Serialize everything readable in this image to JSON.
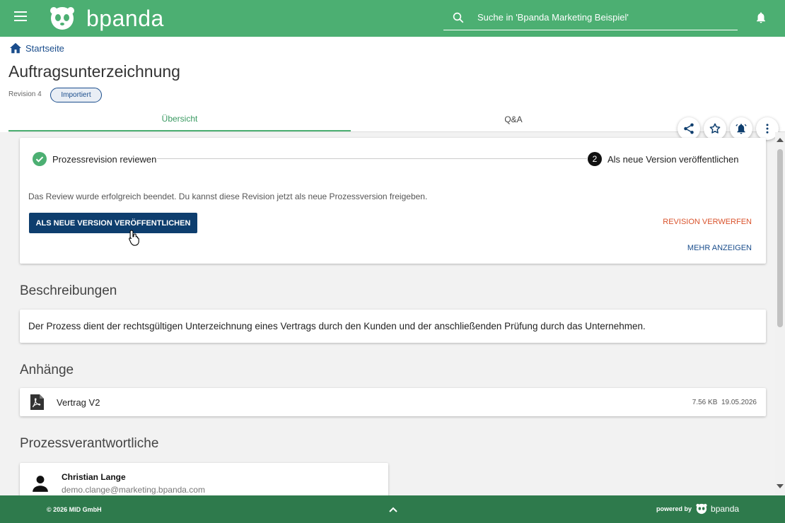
{
  "topbar": {
    "brand": "bpanda",
    "search_placeholder": "Suche in 'Bpanda Marketing Beispiel'"
  },
  "breadcrumb": {
    "home": "Startseite"
  },
  "page": {
    "title": "Auftragsunterzeichnung",
    "revision": "Revision 4",
    "status_badge": "Importiert"
  },
  "tabs": [
    {
      "label": "Übersicht",
      "active": true
    },
    {
      "label": "Q&A",
      "active": false
    }
  ],
  "stepper": {
    "step1": "Prozessrevision reviewen",
    "step2_number": "2",
    "step2": "Als neue Version veröffentlichen",
    "message": "Das Review wurde erfolgreich beendet. Du kannst diese Revision jetzt als neue Prozessversion freigeben.",
    "publish_label": "ALS NEUE VERSION VERÖFFENTLICHEN",
    "discard_label": "REVISION VERWERFEN",
    "more_label": "MEHR ANZEIGEN"
  },
  "descriptions": {
    "title": "Beschreibungen",
    "text": "Der Prozess dient der rechtsgültigen Unterzeichnung eines Vertrags durch den Kunden und der anschließenden Prüfung durch das Unternehmen."
  },
  "attachments": {
    "title": "Anhänge",
    "items": [
      {
        "name": "Vertrag V2",
        "size": "7.56 KB",
        "date": "19.05.2026"
      }
    ]
  },
  "owners": {
    "title": "Prozessverantwortliche",
    "items": [
      {
        "name": "Christian Lange",
        "email": "demo.clange@marketing.bpanda.com"
      }
    ]
  },
  "footer": {
    "copyright": "© 2026 MID GmbH",
    "powered_by": "powered by",
    "brand": "bpanda"
  },
  "colors": {
    "topbar": "#4caf72",
    "footer": "#2e7a4c",
    "primary_button": "#0e3e6e",
    "discard": "#d9532c",
    "link": "#1a4d8c"
  }
}
